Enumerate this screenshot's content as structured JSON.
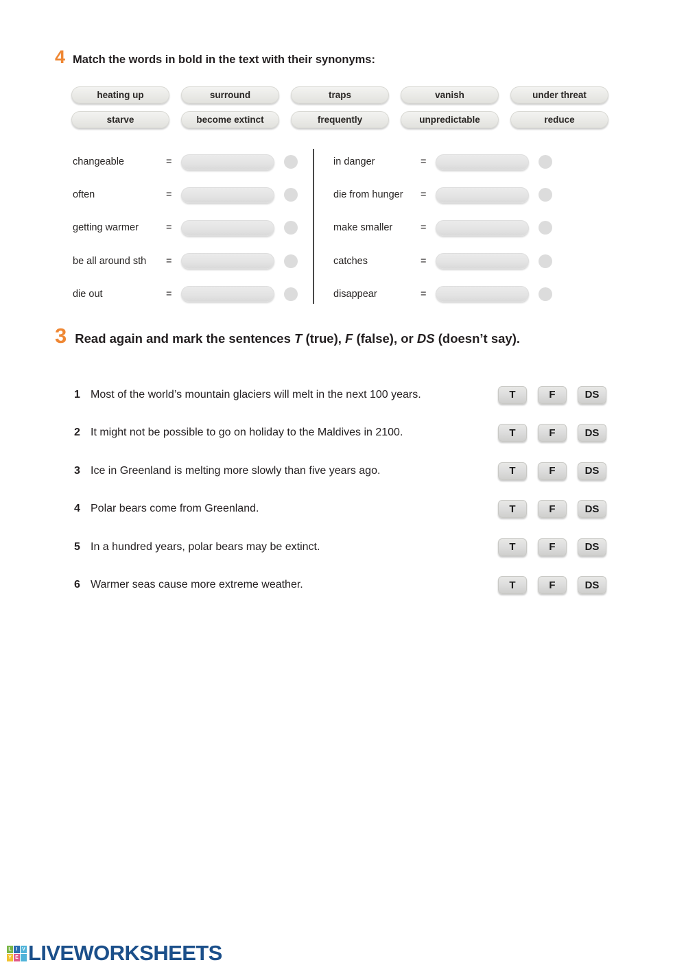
{
  "page": {
    "background": "#ffffff",
    "accent_orange": "#ef8733"
  },
  "exercise4": {
    "number": "4",
    "title": "Match the words in bold in the text with their synonyms:",
    "word_bank": [
      "heating up",
      "surround",
      "traps",
      "vanish",
      "under threat",
      "starve",
      "become extinct",
      "frequently",
      "unpredictable",
      "reduce"
    ],
    "equals_sign": "=",
    "left_items": [
      {
        "label": "changeable",
        "value": ""
      },
      {
        "label": "often",
        "value": ""
      },
      {
        "label": "getting warmer",
        "value": ""
      },
      {
        "label": "be all around sth",
        "value": ""
      },
      {
        "label": "die out",
        "value": ""
      }
    ],
    "right_items": [
      {
        "label": "in danger",
        "value": ""
      },
      {
        "label": "die from hunger",
        "value": ""
      },
      {
        "label": "make smaller",
        "value": ""
      },
      {
        "label": "catches",
        "value": ""
      },
      {
        "label": "disappear",
        "value": ""
      }
    ]
  },
  "exercise3": {
    "number": "3",
    "title_parts": {
      "p1": "Read again and mark the sentences ",
      "t": "T",
      "p2": " (true), ",
      "f": "F",
      "p3": " (false), or ",
      "ds": "DS",
      "p4": " (doesn’t say)."
    },
    "options": [
      "T",
      "F",
      "DS"
    ],
    "questions": [
      {
        "number": "1",
        "text": "Most of the world’s mountain glaciers will melt in the next 100 years."
      },
      {
        "number": "2",
        "text": "It might not be possible to go on holiday to the Maldives in 2100."
      },
      {
        "number": "3",
        "text": "Ice in Greenland is melting more slowly than five years ago."
      },
      {
        "number": "4",
        "text": "Polar bears come from Greenland."
      },
      {
        "number": "5",
        "text": "In a hundred years, polar bears may be extinct."
      },
      {
        "number": "6",
        "text": "Warmer seas cause more extreme weather."
      }
    ]
  },
  "footer": {
    "logo_text": "LIVEWORKSHEETS",
    "logo_tiles": [
      {
        "letter": "L",
        "color": "#7ab648"
      },
      {
        "letter": "I",
        "color": "#2b6cb0"
      },
      {
        "letter": "V",
        "color": "#4fb3d9"
      },
      {
        "letter": "Y",
        "color": "#f2c230"
      },
      {
        "letter": "E",
        "color": "#e05a8a"
      },
      {
        "letter": "",
        "color": "#4fb3d9"
      }
    ],
    "logo_color": "#1b4f8a"
  }
}
